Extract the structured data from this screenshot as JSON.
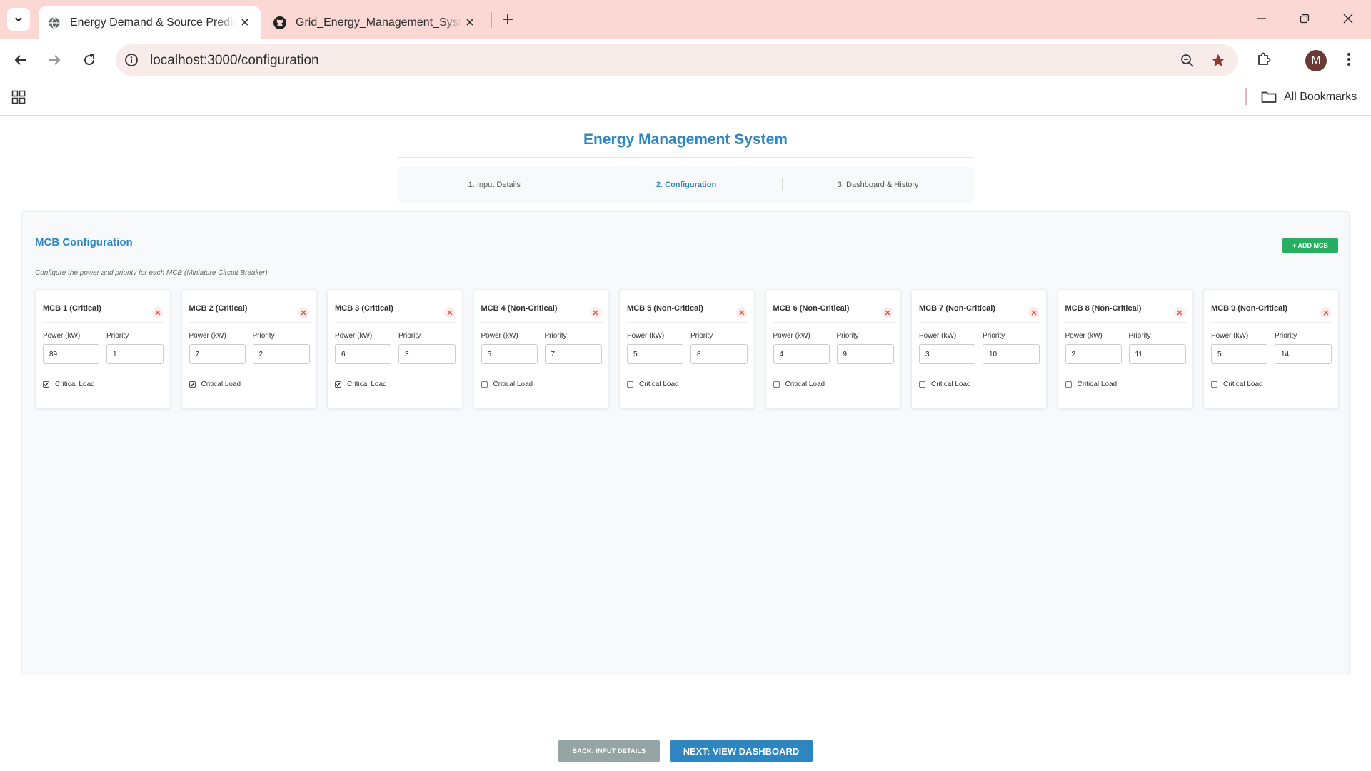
{
  "browser": {
    "tabs": [
      {
        "title": "Energy Demand & Source Prediction",
        "favicon": "globe-icon",
        "active": true
      },
      {
        "title": "Grid_Energy_Management_System",
        "favicon": "github-icon",
        "active": false
      }
    ],
    "url": "localhost:3000/configuration",
    "profile_initial": "M",
    "bookmarks_label": "All Bookmarks"
  },
  "app": {
    "title": "Energy Management System",
    "steps": [
      {
        "label": "1. Input Details",
        "active": false
      },
      {
        "label": "2. Configuration",
        "active": true
      },
      {
        "label": "3. Dashboard & History",
        "active": false
      }
    ]
  },
  "config": {
    "title": "MCB Configuration",
    "add_label": "+ ADD MCB",
    "subtitle": "Configure the power and priority for each MCB (Miniature Circuit Breaker)",
    "power_label": "Power (kW)",
    "priority_label": "Priority",
    "critical_label": "Critical Load",
    "remove_glyph": "×",
    "mcbs": [
      {
        "title": "MCB 1 (Critical)",
        "power": "89",
        "priority": "1",
        "critical": true
      },
      {
        "title": "MCB 2 (Critical)",
        "power": "7",
        "priority": "2",
        "critical": true
      },
      {
        "title": "MCB 3 (Critical)",
        "power": "6",
        "priority": "3",
        "critical": true
      },
      {
        "title": "MCB 4 (Non-Critical)",
        "power": "5",
        "priority": "7",
        "critical": false
      },
      {
        "title": "MCB 5 (Non-Critical)",
        "power": "5",
        "priority": "8",
        "critical": false
      },
      {
        "title": "MCB 6 (Non-Critical)",
        "power": "4",
        "priority": "9",
        "critical": false
      },
      {
        "title": "MCB 7 (Non-Critical)",
        "power": "3",
        "priority": "10",
        "critical": false
      },
      {
        "title": "MCB 8 (Non-Critical)",
        "power": "2",
        "priority": "11",
        "critical": false
      },
      {
        "title": "MCB 9 (Non-Critical)",
        "power": "5",
        "priority": "14",
        "critical": false
      }
    ]
  },
  "actions": {
    "back_label": "BACK: INPUT DETAILS",
    "next_label": "NEXT: VIEW DASHBOARD"
  },
  "colors": {
    "accent": "#2e86c1",
    "add_button": "#27ae60",
    "back_button": "#95a5a6",
    "remove": "#e74c3c",
    "chrome": "#fbd8d3"
  }
}
